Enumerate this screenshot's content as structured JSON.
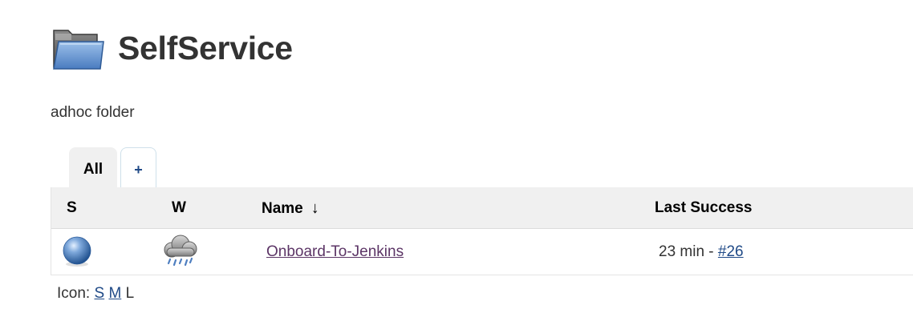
{
  "header": {
    "title": "SelfService",
    "icon": "folder-icon"
  },
  "description": "adhoc folder",
  "tabs": [
    {
      "label": "All",
      "active": true
    },
    {
      "label": "+",
      "active": false
    }
  ],
  "table": {
    "columns": {
      "status": "S",
      "weather": "W",
      "name": "Name",
      "name_sort": "↓",
      "last_success": "Last Success"
    },
    "rows": [
      {
        "status_icon": "blue-ball-icon",
        "weather_icon": "storm-cloud-icon",
        "name": "Onboard-To-Jenkins",
        "last_success_time": "23 min - ",
        "last_success_build": "#26"
      }
    ]
  },
  "icon_legend": {
    "label": "Icon: ",
    "sizes": [
      "S",
      "M",
      "L"
    ]
  },
  "colors": {
    "link": "#204a87",
    "visited_link": "#5c3566",
    "header_bg": "#f0f0f0",
    "text": "#333333"
  }
}
